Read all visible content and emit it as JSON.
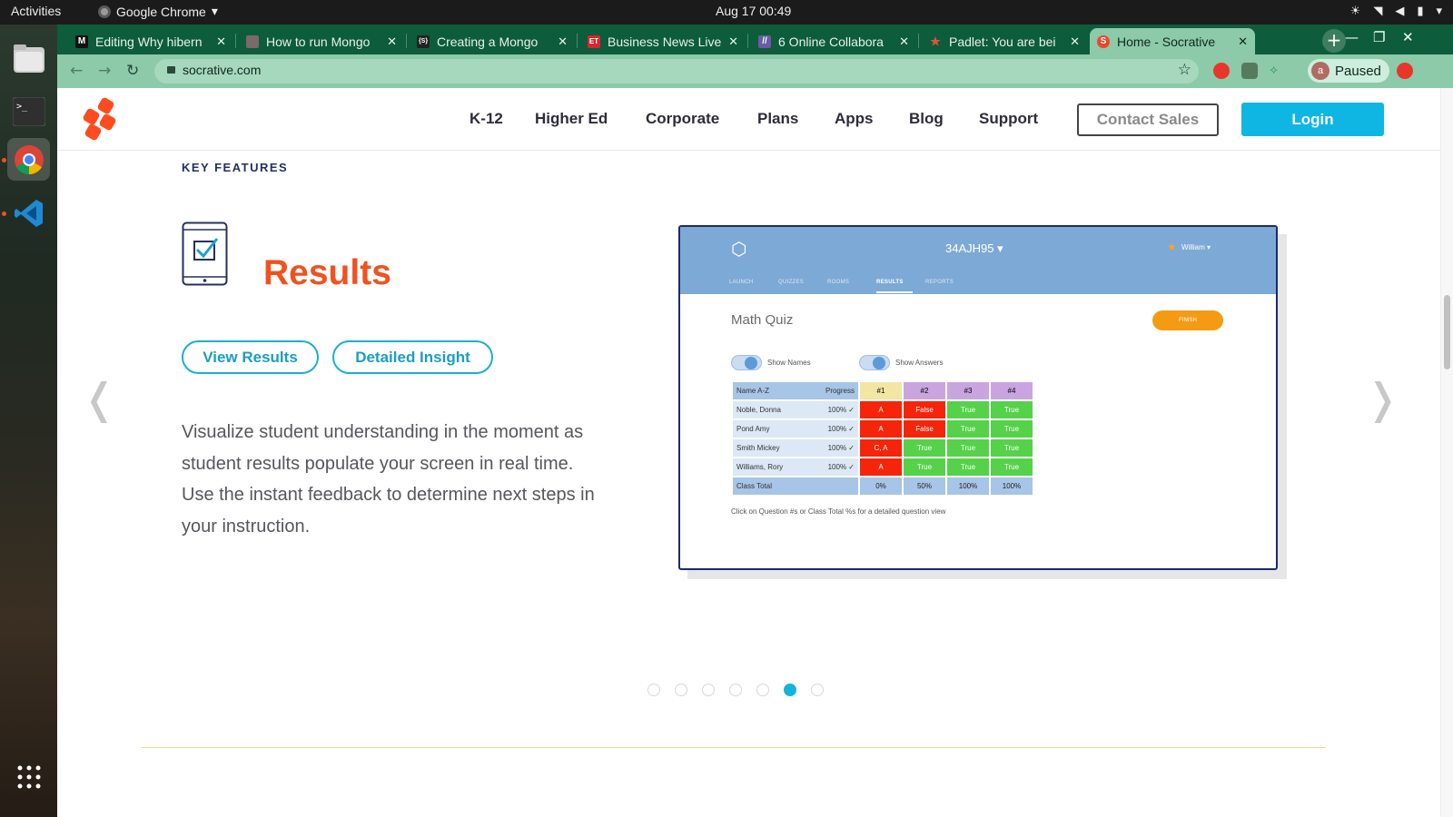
{
  "system": {
    "activities": "Activities",
    "app_name": "Google Chrome",
    "clock": "Aug 17  00:49"
  },
  "browser": {
    "tabs": [
      {
        "label": "Editing Why hibern",
        "favicon": "M",
        "favicon_color": "#111111"
      },
      {
        "label": "How to run Mongo",
        "favicon": "",
        "favicon_color": "#7a6a6a"
      },
      {
        "label": "Creating a Mongo",
        "favicon": "{S}",
        "favicon_color": "#222222"
      },
      {
        "label": "Business News Live",
        "favicon": "ET",
        "favicon_color": "#d9262c"
      },
      {
        "label": "6 Online Collabora",
        "favicon": "//",
        "favicon_color": "#6b5aa6"
      },
      {
        "label": "Padlet: You are bei",
        "favicon": "★",
        "favicon_color": "#e0533d"
      },
      {
        "label": "Home - Socrative",
        "favicon": "S",
        "favicon_color": "#f0442b"
      }
    ],
    "url": "socrative.com",
    "profile_initial": "a",
    "profile_status": "Paused"
  },
  "site": {
    "nav": [
      "K-12",
      "Higher Ed",
      "Corporate",
      "Plans",
      "Apps",
      "Blog",
      "Support"
    ],
    "contact_label": "Contact Sales",
    "login_label": "Login",
    "kicker": "KEY FEATURES",
    "feature_title": "Results",
    "pill_view": "View Results",
    "pill_detail": "Detailed Insight",
    "description": "Visualize student understanding in the moment as student results populate your screen in real time. Use the instant feedback to determine next steps in your instruction.",
    "arrow_prev": "❬",
    "arrow_next": "❭",
    "slide_count": 7,
    "active_slide": 6
  },
  "preview": {
    "room_code": "34AJH95",
    "user": "William",
    "tabs": [
      "LAUNCH",
      "QUIZZES",
      "ROOMS",
      "RESULTS",
      "REPORTS"
    ],
    "active_tab": "RESULTS",
    "quiz_title": "Math Quiz",
    "finish_label": "FINISH",
    "toggle_names": "Show Names",
    "toggle_answers": "Show Answers",
    "table_header": {
      "name": "Name",
      "sort": "A-Z",
      "progress": "Progress",
      "q1": "#1",
      "q2": "#2",
      "q3": "#3",
      "q4": "#4"
    },
    "rows": [
      {
        "name": "Noble, Donna",
        "progress": "100% ✓",
        "a1": "A",
        "a2": "False",
        "a3": "True",
        "a4": "True"
      },
      {
        "name": "Pond Amy",
        "progress": "100% ✓",
        "a1": "A",
        "a2": "False",
        "a3": "True",
        "a4": "True"
      },
      {
        "name": "Smith Mickey",
        "progress": "100% ✓",
        "a1": "C, A",
        "a2": "True",
        "a3": "True",
        "a4": "True"
      },
      {
        "name": "Williams, Rory",
        "progress": "100% ✓",
        "a1": "A",
        "a2": "True",
        "a3": "True",
        "a4": "True"
      }
    ],
    "total_label": "Class Total",
    "totals": [
      "0%",
      "50%",
      "100%",
      "100%"
    ],
    "hint": "Click on Question #s or Class Total %s for a detailed question view"
  }
}
